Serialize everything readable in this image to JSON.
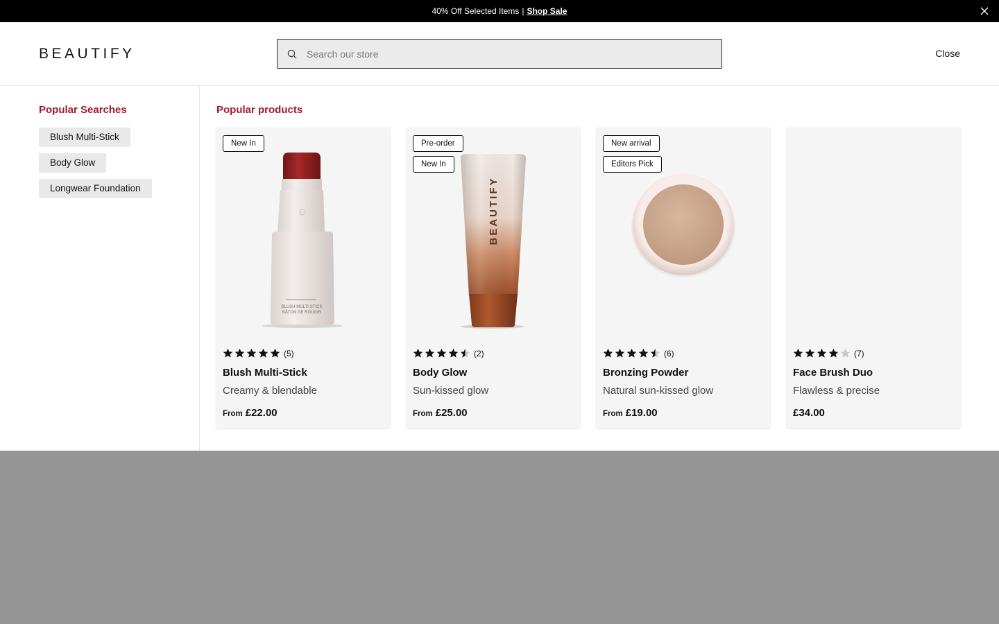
{
  "promo": {
    "text": "40% Off Selected Items",
    "separator": "|",
    "link": "Shop Sale"
  },
  "header": {
    "logo": "BEAUTIFY",
    "search_placeholder": "Search our store",
    "close_label": "Close"
  },
  "popular_searches": {
    "title": "Popular Searches",
    "items": [
      "Blush Multi-Stick",
      "Body Glow",
      "Longwear Foundation"
    ]
  },
  "popular_products": {
    "title": "Popular products",
    "items": [
      {
        "badges": [
          "New In"
        ],
        "rating": 5,
        "reviews": "(5)",
        "name": "Blush Multi-Stick",
        "tagline": "Creamy & blendable",
        "from": "From",
        "price": "£22.00",
        "image": "blush-stick"
      },
      {
        "badges": [
          "Pre-order",
          "New In"
        ],
        "rating": 4.5,
        "reviews": "(2)",
        "name": "Body Glow",
        "tagline": "Sun-kissed glow",
        "from": "From",
        "price": "£25.00",
        "image": "tube"
      },
      {
        "badges": [
          "New arrival",
          "Editors Pick"
        ],
        "rating": 4.5,
        "reviews": "(6)",
        "name": "Bronzing Powder",
        "tagline": "Natural sun-kissed glow",
        "from": "From",
        "price": "£19.00",
        "image": "compact"
      },
      {
        "badges": [],
        "rating": 4,
        "reviews": "(7)",
        "name": "Face Brush Duo",
        "tagline": "Flawless & precise",
        "from": "",
        "price": "£34.00",
        "image": "none"
      }
    ]
  },
  "colors": {
    "accent": "#a3182f",
    "promo_bg": "#000000",
    "overlay": "#959595",
    "card_bg": "#f5f5f5"
  },
  "icons": {
    "search": "search-icon",
    "close": "close-icon",
    "star": "star-icon"
  }
}
